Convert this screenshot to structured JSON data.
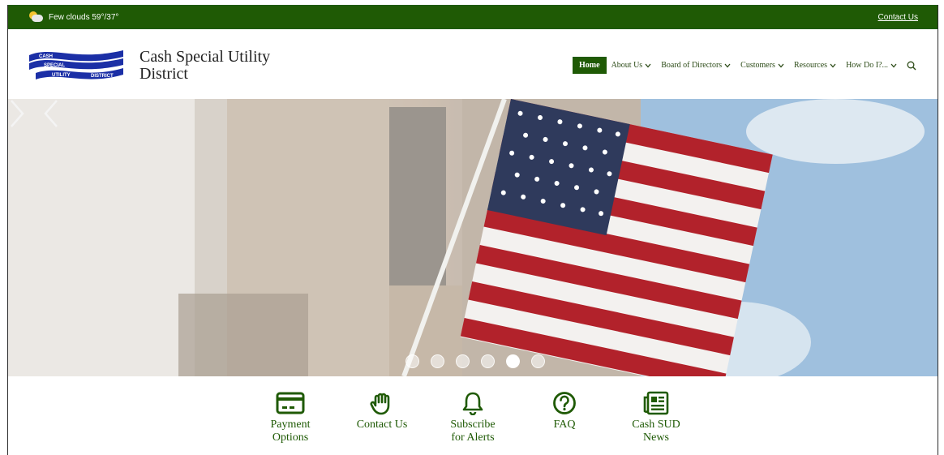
{
  "topbar": {
    "weather": "Few clouds 59°/37°",
    "contact_link": "Contact Us"
  },
  "header": {
    "logo_text": [
      "CASH",
      "SPECIAL",
      "UTILITY",
      "DISTRICT"
    ],
    "site_name_line1": "Cash Special Utility",
    "site_name_line2": "District"
  },
  "nav": {
    "items": [
      {
        "label": "Home",
        "active": true
      },
      {
        "label": "About Us"
      },
      {
        "label": "Board of Directors"
      },
      {
        "label": "Customers"
      },
      {
        "label": "Resources"
      },
      {
        "label": "How Do I?..."
      }
    ]
  },
  "hero": {
    "slide_count": 6,
    "active_slide": 5
  },
  "quick_links": [
    {
      "label_line1": "Payment",
      "label_line2": "Options",
      "icon": "credit-card-icon"
    },
    {
      "label_line1": "Contact Us",
      "label_line2": "",
      "icon": "hand-icon"
    },
    {
      "label_line1": "Subscribe",
      "label_line2": "for Alerts",
      "icon": "bell-icon"
    },
    {
      "label_line1": "FAQ",
      "label_line2": "",
      "icon": "question-icon"
    },
    {
      "label_line1": "Cash SUD",
      "label_line2": "News",
      "icon": "newspaper-icon"
    }
  ],
  "colors": {
    "brand_green": "#1f5a05",
    "logo_blue": "#1b2fa6"
  }
}
